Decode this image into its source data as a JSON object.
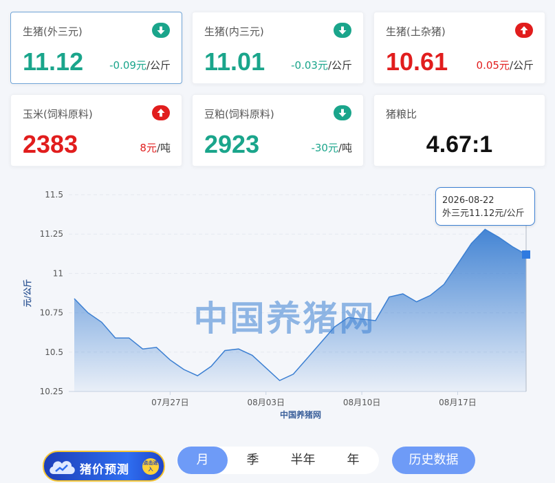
{
  "cards": [
    {
      "title": "生猪(外三元)",
      "price": "11.12",
      "change_value": "-0.09元",
      "change_unit": "/公斤",
      "direction": "down",
      "arrow_icon": "arrow-down-icon"
    },
    {
      "title": "生猪(内三元)",
      "price": "11.01",
      "change_value": "-0.03元",
      "change_unit": "/公斤",
      "direction": "down",
      "arrow_icon": "arrow-down-icon"
    },
    {
      "title": "生猪(土杂猪)",
      "price": "10.61",
      "change_value": "0.05元",
      "change_unit": "/公斤",
      "direction": "up",
      "arrow_icon": "arrow-up-icon"
    },
    {
      "title": "玉米(饲料原料)",
      "price": "2383",
      "change_value": "8元",
      "change_unit": "/吨",
      "direction": "up",
      "arrow_icon": "arrow-up-icon"
    },
    {
      "title": "豆粕(饲料原料)",
      "price": "2923",
      "change_value": "-30元",
      "change_unit": "/吨",
      "direction": "down",
      "arrow_icon": "arrow-down-icon"
    },
    {
      "title": "猪粮比",
      "ratio": "4.67:1"
    }
  ],
  "colors": {
    "down": "#1aa58b",
    "up": "#e11d1d",
    "accent": "#6e9bf7",
    "series": "#3b7fd2"
  },
  "chart_data": {
    "type": "area",
    "ylabel": "元/公斤",
    "xlabel": "中国养猪网",
    "watermark": "中国养猪网",
    "ylim": [
      10.25,
      11.5
    ],
    "yticks": [
      "10.25",
      "10.5",
      "10.75",
      "11",
      "11.25",
      "11.5"
    ],
    "xticks": [
      {
        "label": "07月27日",
        "x": 8
      },
      {
        "label": "08月03日",
        "x": 15
      },
      {
        "label": "08月10日",
        "x": 22
      },
      {
        "label": "08月17日",
        "x": 29
      }
    ],
    "grid": true,
    "x": [
      1,
      2,
      3,
      4,
      5,
      6,
      7,
      8,
      9,
      10,
      11,
      12,
      13,
      14,
      15,
      16,
      17,
      18,
      19,
      20,
      21,
      22,
      23,
      24,
      25,
      26,
      27,
      28,
      29,
      30,
      31,
      32,
      33,
      34,
      35
    ],
    "series": [
      {
        "values": [
          10.84,
          10.75,
          10.69,
          10.59,
          10.59,
          10.52,
          10.53,
          10.45,
          10.39,
          10.35,
          10.41,
          10.51,
          10.52,
          10.48,
          10.4,
          10.32,
          10.36,
          10.46,
          10.56,
          10.66,
          10.72,
          10.71,
          10.7,
          10.85,
          10.87,
          10.82,
          10.86,
          10.93,
          11.06,
          11.19,
          11.28,
          11.23,
          11.17,
          11.12
        ]
      }
    ],
    "tooltip": {
      "date": "2026-08-22",
      "text": "外三元11.12元/公斤"
    }
  },
  "promo": {
    "label": "猪价预测",
    "badge": "点击进入",
    "icon": "cloud-chart-icon"
  },
  "period_tabs": [
    {
      "label": "月",
      "active": true
    },
    {
      "label": "季",
      "active": false
    },
    {
      "label": "半年",
      "active": false
    },
    {
      "label": "年",
      "active": false
    }
  ],
  "history_button": "历史数据"
}
